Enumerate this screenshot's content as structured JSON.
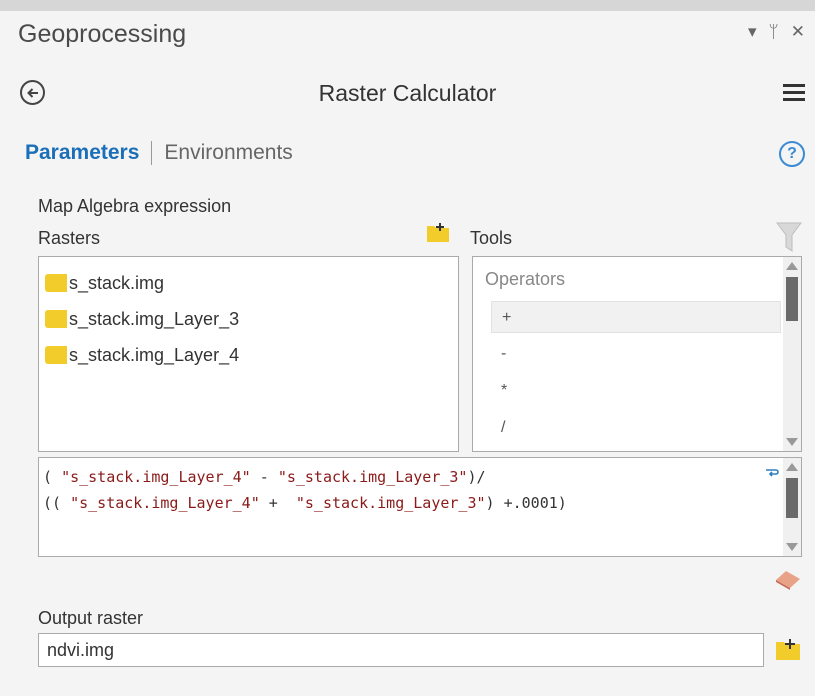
{
  "pane": {
    "title": "Geoprocessing",
    "controls": [
      "▾",
      "ᛘ",
      "✕"
    ]
  },
  "tool": {
    "title": "Raster Calculator"
  },
  "tabs": {
    "parameters": "Parameters",
    "environments": "Environments"
  },
  "help": {
    "label": "?"
  },
  "expression_section": {
    "label": "Map Algebra expression"
  },
  "rasters": {
    "label": "Rasters",
    "items": [
      "s_stack.img",
      "s_stack.img_Layer_3",
      "s_stack.img_Layer_4"
    ]
  },
  "tools": {
    "label": "Tools",
    "heading": "Operators",
    "operators": [
      "+",
      "-",
      "*",
      "/"
    ],
    "selected": "+"
  },
  "expression": {
    "line1": {
      "a": "( ",
      "b": "\"s_stack.img_Layer_4\"",
      "c": " - ",
      "d": "\"s_stack.img_Layer_3\"",
      "e": ")/"
    },
    "line2": {
      "a": "(( ",
      "b": "\"s_stack.img_Layer_4\"",
      "c": " +  ",
      "d": "\"s_stack.img_Layer_3\"",
      "e": ") +.0001)"
    }
  },
  "output": {
    "label": "Output raster",
    "value": "ndvi.img"
  },
  "colors": {
    "accent": "#1a6fb8",
    "folder": "#f2cc2b",
    "string": "#8b1a1a"
  },
  "icons": [
    "back-arrow-icon",
    "menu-icon",
    "help-icon",
    "add-raster-icon",
    "filter-icon",
    "wrap-icon",
    "eraser-icon",
    "browse-folder-icon"
  ]
}
